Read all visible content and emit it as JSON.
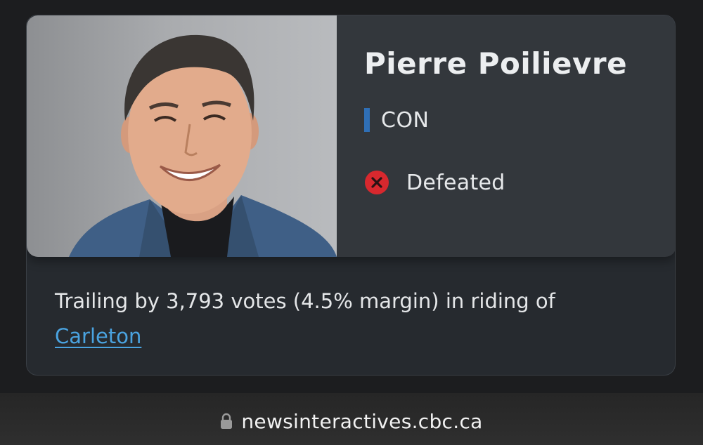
{
  "candidate": {
    "name": "Pierre Poilievre",
    "party": "CON",
    "party_color": "#2f6fb6",
    "status": "Defeated",
    "status_icon": "x-circle-icon",
    "status_color": "#d8282e"
  },
  "result": {
    "summary": "Trailing by 3,793 votes (4.5% margin) in riding of",
    "riding": "Carleton"
  },
  "browser": {
    "url": "newsinteractives.cbc.ca",
    "lock_icon": "lock-icon"
  }
}
